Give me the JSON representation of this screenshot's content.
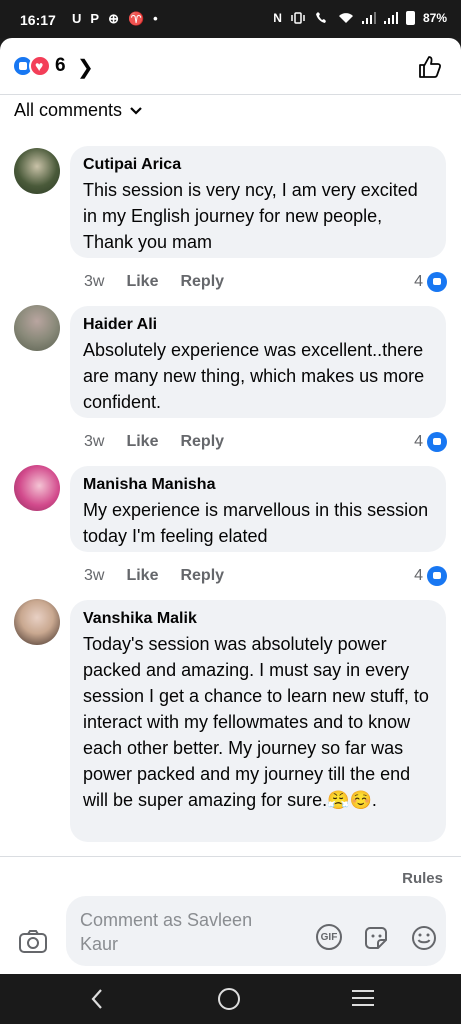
{
  "status_bar": {
    "time": "16:17",
    "left_icons": [
      "U",
      "P",
      "⊕",
      "♈",
      "•"
    ],
    "network_label": "N",
    "battery_label": "87%"
  },
  "reactions": {
    "count": "6",
    "icons": [
      "like-icon",
      "love-icon"
    ]
  },
  "filter": {
    "label": "All comments"
  },
  "comments": [
    {
      "author": "Cutipai Arica",
      "text": "This session is very ncy, I am very excited in my English journey for new people, Thank you mam",
      "time": "3w",
      "like_label": "Like",
      "reply_label": "Reply",
      "likes": "4",
      "avatar_color": "#4a5a3a"
    },
    {
      "author": "Haider Ali",
      "text": "Absolutely experience was excellent..there are many new thing, which makes us more confident.",
      "time": "3w",
      "like_label": "Like",
      "reply_label": "Reply",
      "likes": "4",
      "avatar_color": "#8a8a7a"
    },
    {
      "author": "Manisha Manisha",
      "text": "My experience is marvellous in this session today I'm feeling elated",
      "time": "3w",
      "like_label": "Like",
      "reply_label": "Reply",
      "likes": "4",
      "avatar_color": "#d24a8c"
    },
    {
      "author": "Vanshika Malik",
      "text": "Today's session was absolutely power packed and amazing. I must say in every session I get a chance to learn new stuff, to interact with my fellowmates and to know each other better. My journey so far was power packed and my journey till the end will be super amazing for sure.😤☺️.",
      "avatar_color": "#c9a890"
    }
  ],
  "rules_label": "Rules",
  "composer": {
    "placeholder": "Comment as Savleen Kaur",
    "gif_label": "GIF"
  },
  "colors": {
    "facebook_blue": "#1877f2",
    "love_red": "#f33e58",
    "bubble_bg": "#f0f2f5",
    "secondary_text": "#65676b"
  }
}
